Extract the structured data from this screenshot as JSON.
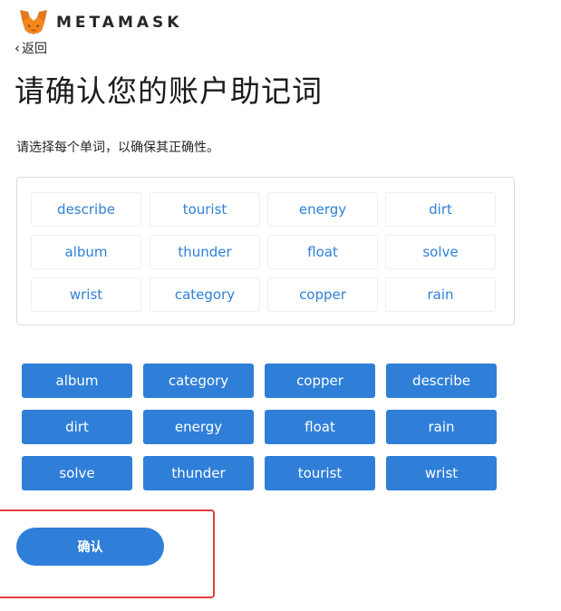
{
  "header": {
    "brand": "METAMASK"
  },
  "nav": {
    "back_label": "返回"
  },
  "page": {
    "title": "请确认您的账户助记词",
    "subtitle": "请选择每个单词，以确保其正确性。"
  },
  "selected_words": [
    "describe",
    "tourist",
    "energy",
    "dirt",
    "album",
    "thunder",
    "float",
    "solve",
    "wrist",
    "category",
    "copper",
    "rain"
  ],
  "word_buttons": [
    "album",
    "category",
    "copper",
    "describe",
    "dirt",
    "energy",
    "float",
    "rain",
    "solve",
    "thunder",
    "tourist",
    "wrist"
  ],
  "actions": {
    "confirm_label": "确认"
  },
  "colors": {
    "accent": "#2f7fd8",
    "word_text": "#2f80d6",
    "highlight": "#e24040"
  }
}
